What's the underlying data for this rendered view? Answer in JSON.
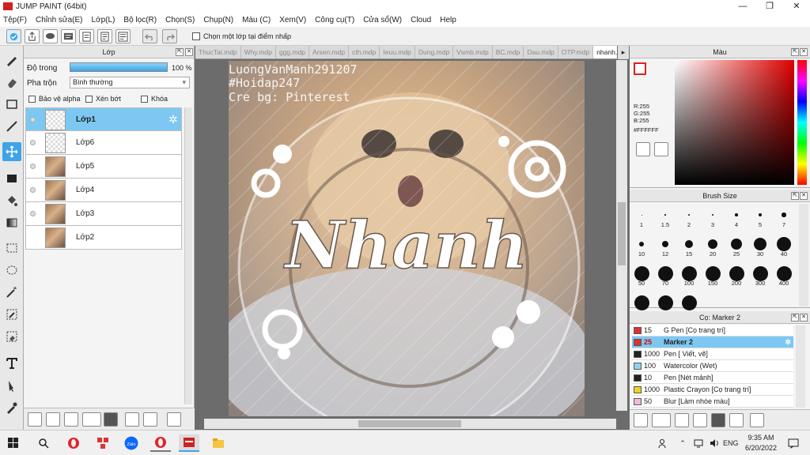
{
  "app": {
    "title": "JUMP PAINT (64bit)",
    "logo": "JUMP PAINT"
  },
  "menu": [
    "Tệp(F)",
    "Chỉnh sửa(E)",
    "Lớp(L)",
    "Bộ lọc(R)",
    "Chọn(S)",
    "Chụp(N)",
    "Màu (C)",
    "Xem(V)",
    "Công cụ(T)",
    "Cửa sổ(W)",
    "Cloud",
    "Help"
  ],
  "toolbar": {
    "checkbox_label": "Chọn một lớp tại điểm nhấp"
  },
  "layer_panel": {
    "title": "Lớp",
    "opacity_label": "Độ trong",
    "opacity_value": "100 %",
    "opacity": 1.0,
    "blend_label": "Pha trộn",
    "blend_value": "Bình thường",
    "protect_alpha": "Bảo vệ alpha",
    "clipping": "Xén bớt",
    "lock": "Khóa",
    "layers": [
      {
        "name": "Lớp1",
        "selected": true,
        "thumb": "empty"
      },
      {
        "name": "Lớp6",
        "selected": false,
        "thumb": "empty"
      },
      {
        "name": "Lớp5",
        "selected": false,
        "thumb": "image"
      },
      {
        "name": "Lớp4",
        "selected": false,
        "thumb": "image"
      },
      {
        "name": "Lớp3",
        "selected": false,
        "thumb": "image"
      },
      {
        "name": "Lớp2",
        "selected": false,
        "thumb": "image"
      }
    ]
  },
  "tabs": [
    "ThucTai.mdp",
    "Why.mdp",
    "ggg.mdp",
    "Arsen.mdp",
    "cth.mdp",
    "Ieuu.mdp",
    "Dung.mdp",
    "Vsmb.mdp",
    "BC.mdp",
    "Dau.mdp",
    "OTP.mdp",
    "nhanh.mdp"
  ],
  "active_tab": "nhanh.mdp",
  "artwork": {
    "line1": "LuongVanManh291207",
    "line2": "#Hoidap247",
    "line3": "Cre bg:  Pinterest",
    "main_text": "Nhanh"
  },
  "color_panel": {
    "title": "Màu",
    "r": "R:255",
    "g": "G:255",
    "b": "B:255",
    "hex": "#FFFFFF"
  },
  "brush_size_panel": {
    "title": "Brush Size",
    "sizes": [
      "1",
      "1.5",
      "2",
      "3",
      "4",
      "5",
      "7",
      "10",
      "12",
      "15",
      "20",
      "25",
      "30",
      "40",
      "50",
      "70",
      "100",
      "150",
      "200",
      "300",
      "400",
      "",
      "",
      ""
    ]
  },
  "pen_panel": {
    "title": "Cọ: Marker 2",
    "items": [
      {
        "size": "15",
        "name": "G Pen [Cọ trang trí]",
        "color": "#e03030",
        "selected": false
      },
      {
        "size": "25",
        "name": "Marker 2",
        "color": "#e03030",
        "selected": true
      },
      {
        "size": "1000",
        "name": "Pen [ Viết, vẽ]",
        "color": "#222222",
        "selected": false
      },
      {
        "size": "100",
        "name": "Watercolor (Wet)",
        "color": "#8fd3f0",
        "selected": false
      },
      {
        "size": "10",
        "name": "Pen [Nét mảnh]",
        "color": "#222222",
        "selected": false
      },
      {
        "size": "1000",
        "name": "Plastic Crayon [Cọ trang trí]",
        "color": "#f0d020",
        "selected": false
      },
      {
        "size": "50",
        "name": "Blur [Làm nhòe màu]",
        "color": "#f4b8d8",
        "selected": false
      }
    ]
  },
  "taskbar": {
    "time": "9:35 AM",
    "date": "6/20/2022",
    "lang": "ENG"
  },
  "colors": {
    "accent": "#3fa3e8",
    "selection": "#7cc8f2"
  }
}
